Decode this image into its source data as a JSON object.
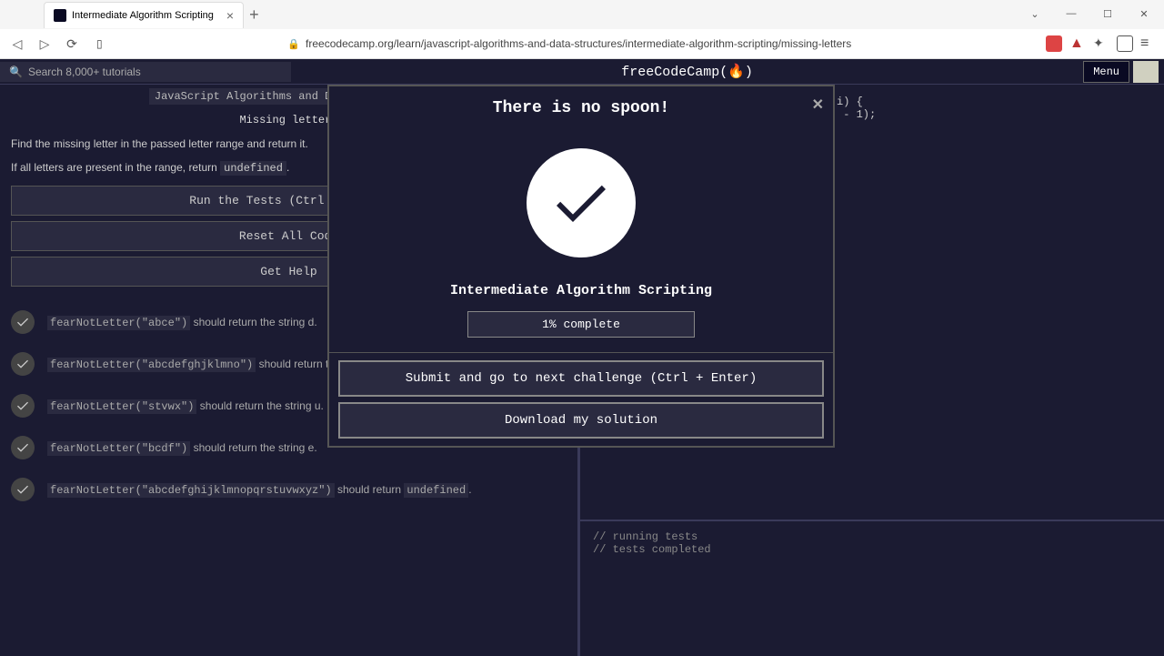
{
  "browser": {
    "tab_title": "Intermediate Algorithm Scripting",
    "url": "freecodecamp.org/learn/javascript-algorithms-and-data-structures/intermediate-algorithm-scripting/missing-letters"
  },
  "header": {
    "search_placeholder": "Search 8,000+ tutorials",
    "logo": "freeCodeCamp(🔥)",
    "menu_label": "Menu"
  },
  "breadcrumb": "JavaScript Algorithms and Data Structures",
  "challenge_title": "Missing letters",
  "desc_line1": "Find the missing letter in the passed letter range and return it.",
  "desc_line2_pre": "If all letters are present in the range, return ",
  "desc_line2_code": "undefined",
  "buttons": {
    "run_tests": "Run the Tests (Ctrl + Enter)",
    "reset": "Reset All Code",
    "help": "Get Help"
  },
  "tests": [
    {
      "call": "fearNotLetter(\"abce\")",
      "tail": " should return the string d."
    },
    {
      "call": "fearNotLetter(\"abcdefghjklmno\")",
      "tail": " should return the string i."
    },
    {
      "call": "fearNotLetter(\"stvwx\")",
      "tail": " should return the string u."
    },
    {
      "call": "fearNotLetter(\"bcdf\")",
      "tail": " should return the string e."
    },
    {
      "call": "fearNotLetter(\"abcdefghijklmnopqrstuvwxyz\")",
      "tail_pre": " should return ",
      "tail_code": "undefined",
      "tail_post": "."
    }
  ],
  "code_lines": [
    "i) {",
    " - 1);"
  ],
  "console_lines": [
    "// running tests",
    "// tests completed"
  ],
  "modal": {
    "title": "There is no spoon!",
    "section": "Intermediate Algorithm Scripting",
    "progress": "1% complete",
    "submit": "Submit and go to next challenge (Ctrl + Enter)",
    "download": "Download my solution"
  }
}
